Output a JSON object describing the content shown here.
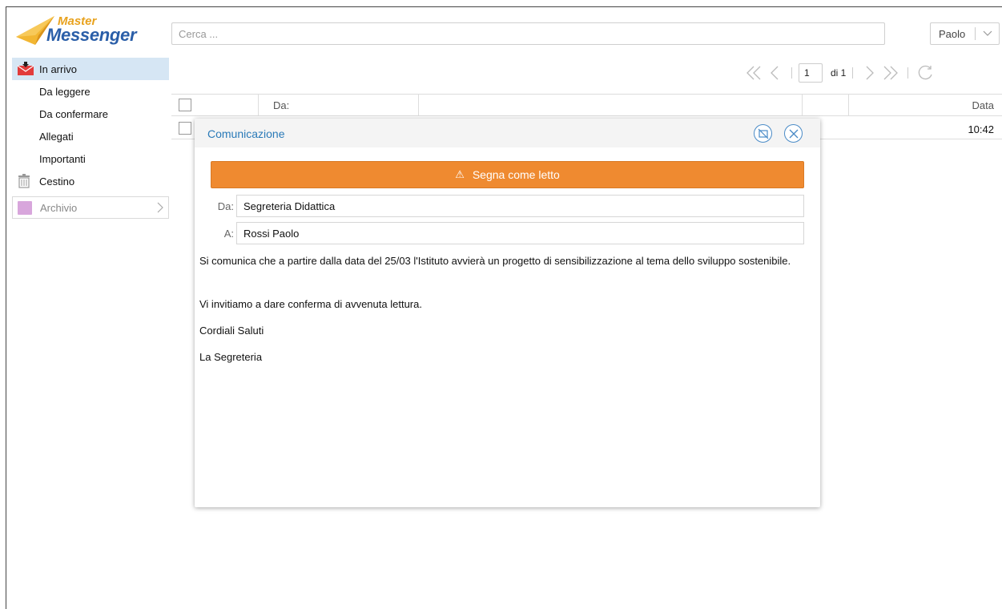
{
  "app": {
    "logo_line1": "Master",
    "logo_line2": "Messenger"
  },
  "search": {
    "placeholder": "Cerca ..."
  },
  "user_menu": {
    "name": "Paolo"
  },
  "sidebar": {
    "items": [
      {
        "label": "In arrivo",
        "icon": "inbox-envelope-icon",
        "active": true
      },
      {
        "label": "Da leggere"
      },
      {
        "label": "Da confermare"
      },
      {
        "label": "Allegati"
      },
      {
        "label": "Importanti"
      },
      {
        "label": "Cestino",
        "icon": "trash-icon"
      }
    ],
    "archive_label": "Archivio"
  },
  "pager": {
    "current_page": "1",
    "of_label": "di 1"
  },
  "table": {
    "columns": [
      "Da:",
      "Data"
    ],
    "rows": [
      {
        "time": "10:42"
      }
    ]
  },
  "modal": {
    "title": "Comunicazione",
    "mark_read_label": "Segna come letto",
    "from_label": "Da:",
    "from_value": "Segreteria Didattica",
    "to_label": "A:",
    "to_value": "Rossi Paolo",
    "body": {
      "line1": "Si comunica che a partire dalla data del 25/03 l'Istituto avvierà un progetto di sensibilizzazione al tema dello sviluppo sostenibile.",
      "line2": "Vi invitiamo a dare conferma di avvenuta lettura.",
      "line3": "Cordiali Saluti",
      "line4": "La Segreteria"
    }
  },
  "colors": {
    "accent_blue": "#2a7ab8",
    "mark_button": "#ef8a30",
    "active_sidebar": "#d6e6f4"
  }
}
